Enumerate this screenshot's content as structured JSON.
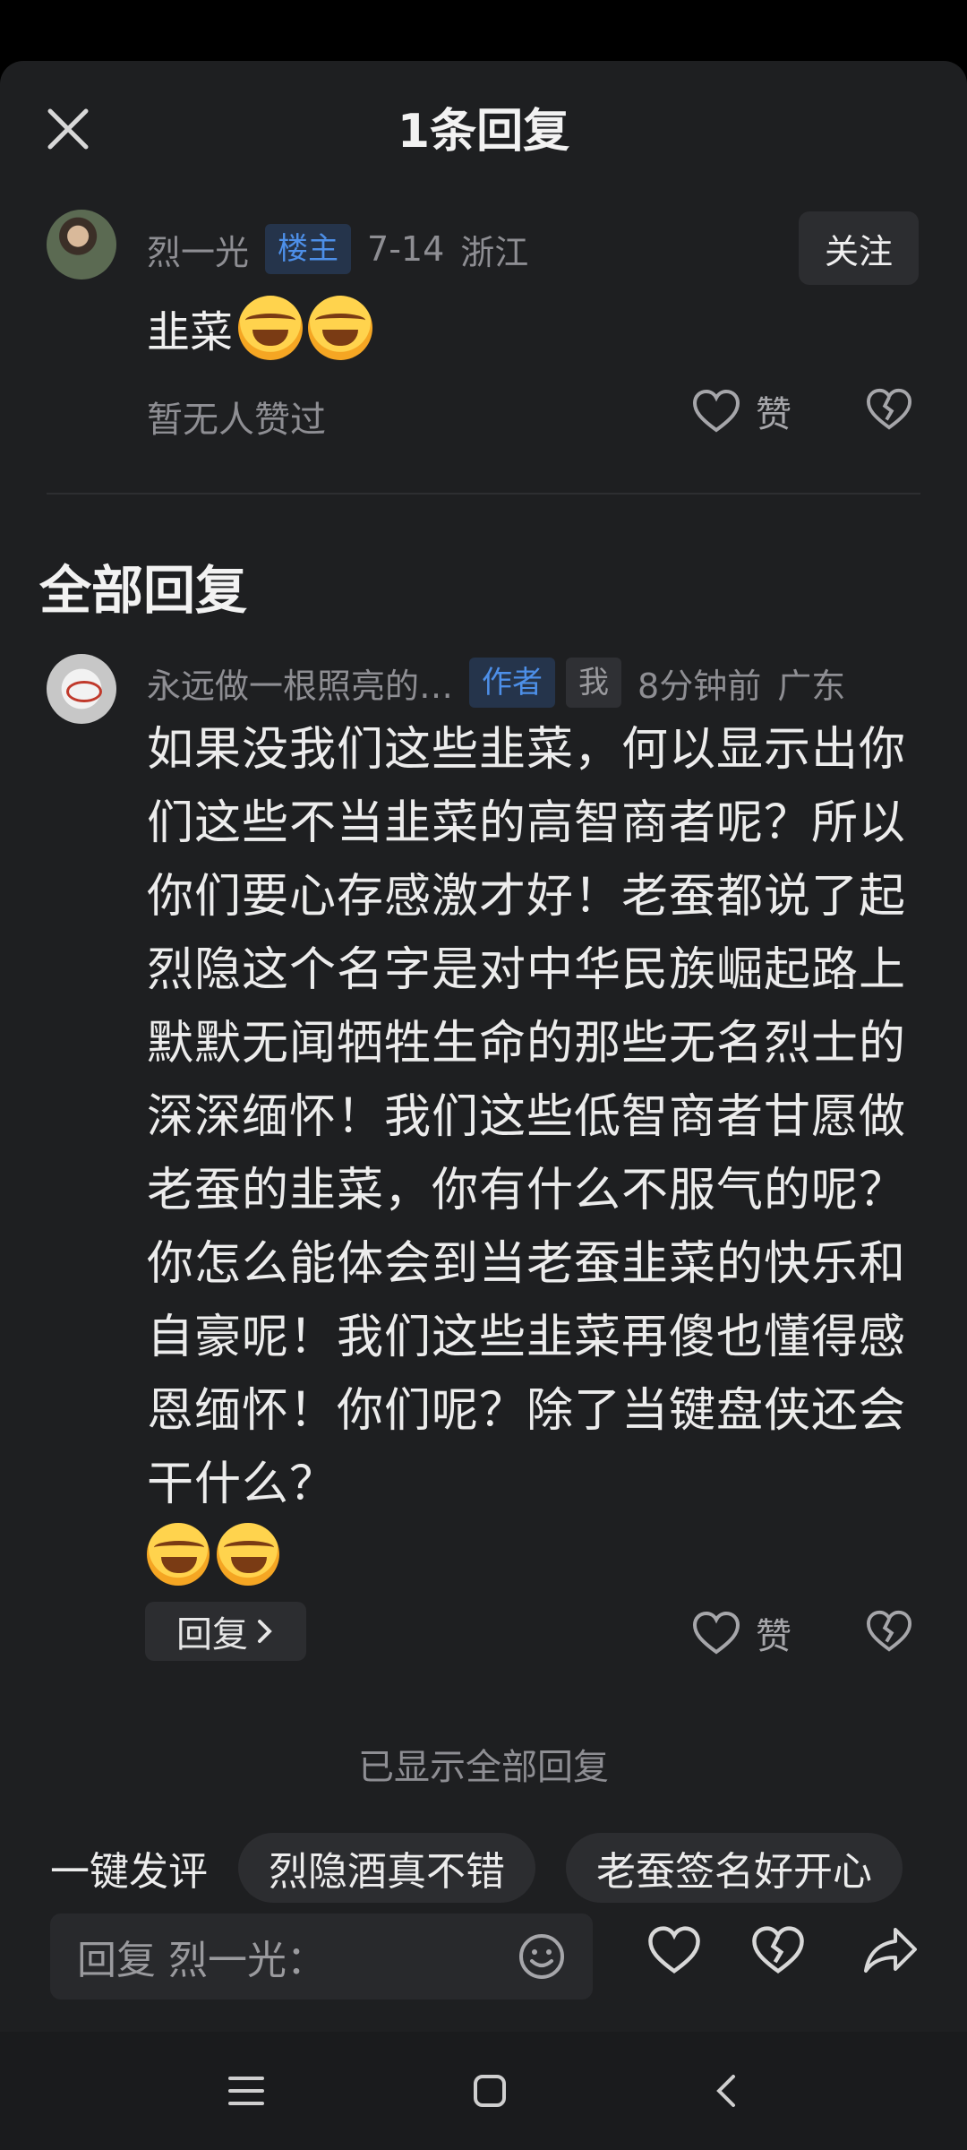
{
  "header": {
    "title": "1条回复"
  },
  "original_comment": {
    "username": "烈一光",
    "badge": "楼主",
    "date": "7-14",
    "location": "浙江",
    "follow_label": "关注",
    "text": "韭菜",
    "emoji_count": 2,
    "likes_text": "暂无人赞过",
    "like_label": "赞"
  },
  "section": {
    "title": "全部回复"
  },
  "reply": {
    "username": "永远做一根照亮的…",
    "badge_author": "作者",
    "badge_me": "我",
    "time": "8分钟前",
    "location": "广东",
    "text": "如果没我们这些韭菜，何以显示出你们这些不当韭菜的高智商者呢？所以你们要心存感激才好！老蚕都说了起烈隐这个名字是对中华民族崛起路上默默无闻牺牲生命的那些无名烈士的深深缅怀！我们这些低智商者甘愿做老蚕的韭菜，你有什么不服气的呢？你怎么能体会到当老蚕韭菜的快乐和自豪呢！我们这些韭菜再傻也懂得感恩缅怀！你们呢？除了当键盘侠还会干什么？",
    "reply_button": "回复",
    "like_label": "赞"
  },
  "footer": {
    "shown_all": "已显示全部回复",
    "quick_label": "一键发评",
    "quick_chips": [
      "烈隐酒真不错",
      "老蚕签名好开心"
    ],
    "input_placeholder": "回复 烈一光："
  },
  "icons": {
    "close": "close-icon",
    "heart": "heart-icon",
    "broken_heart": "broken-heart-icon",
    "smiley": "smiley-icon",
    "share": "share-icon",
    "menu": "menu-icon",
    "home": "home-square-icon",
    "back": "back-chevron-icon"
  },
  "colors": {
    "background": "#1e1f21",
    "badge_blue_text": "#4d8fe8",
    "badge_blue_bg": "#25344b"
  }
}
